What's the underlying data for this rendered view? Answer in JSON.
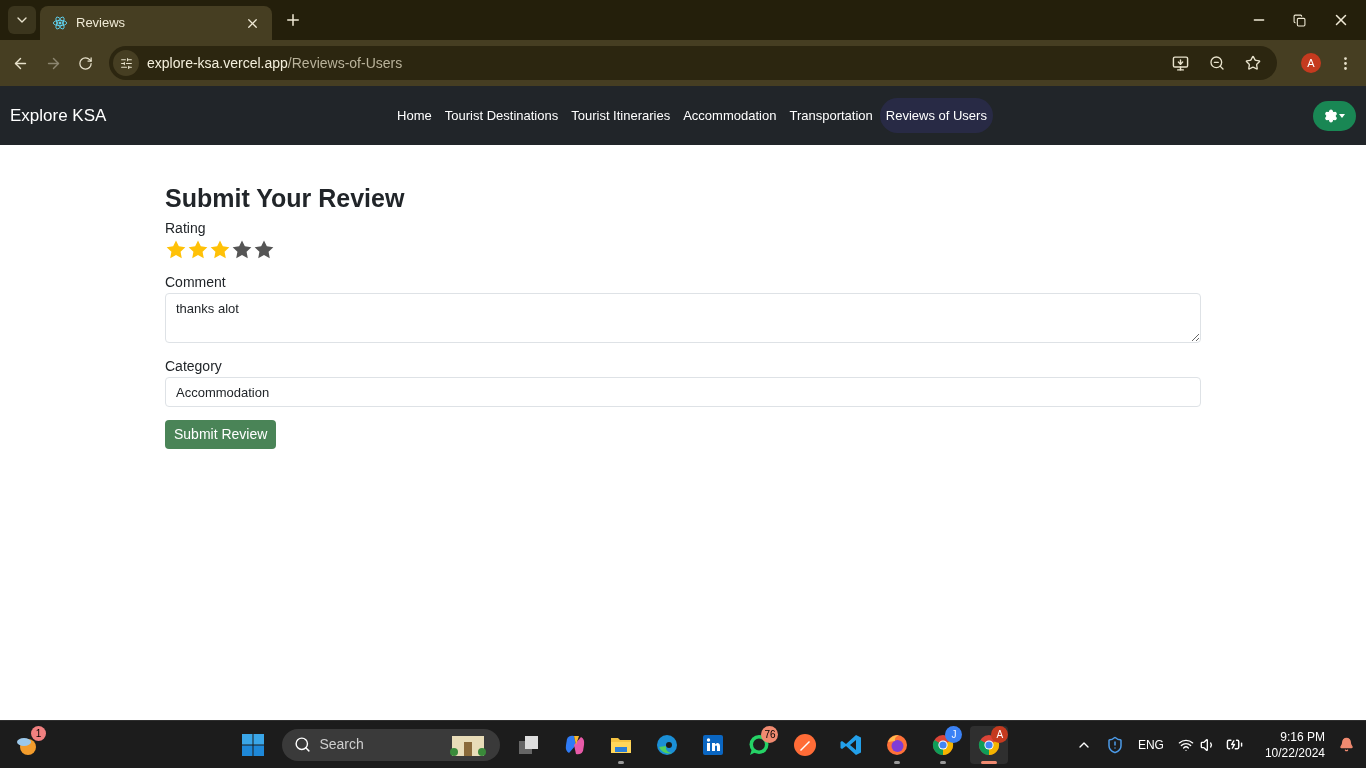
{
  "browser": {
    "tab": {
      "title": "Reviews"
    },
    "url": {
      "host": "explore-ksa.vercel.app",
      "path": "/Reviews-of-Users"
    },
    "profile": "A"
  },
  "navbar": {
    "brand": "Explore KSA",
    "links": [
      {
        "label": "Home",
        "selected": false
      },
      {
        "label": "Tourist Destinations",
        "selected": false
      },
      {
        "label": "Tourist Itineraries",
        "selected": false
      },
      {
        "label": "Accommodation",
        "selected": false
      },
      {
        "label": "Transportation",
        "selected": false
      },
      {
        "label": "Reviews of Users",
        "selected": true
      }
    ]
  },
  "form": {
    "title": "Submit Your Review",
    "rating": {
      "label": "Rating",
      "stars": 3
    },
    "comment": {
      "label": "Comment",
      "value": "thanks alot"
    },
    "category": {
      "label": "Category",
      "value": "Accommodation"
    },
    "submit": "Submit Review"
  },
  "taskbar": {
    "weather_badge": "1",
    "search": {
      "placeholder": "Search"
    },
    "apps": [
      {
        "kind": "start",
        "running": false,
        "active": false
      },
      {
        "kind": "taskview",
        "running": false,
        "active": false
      },
      {
        "kind": "copilot",
        "running": false,
        "active": false
      },
      {
        "kind": "folder",
        "running": true,
        "active": false
      },
      {
        "kind": "edge",
        "running": false,
        "active": false
      },
      {
        "kind": "linkedin",
        "running": false,
        "active": false
      },
      {
        "kind": "whatsapp",
        "running": false,
        "active": false,
        "badge": "76"
      },
      {
        "kind": "postman",
        "running": false,
        "active": false
      },
      {
        "kind": "vscode",
        "running": false,
        "active": false
      },
      {
        "kind": "firefox",
        "running": true,
        "active": false
      },
      {
        "kind": "chrome",
        "running": true,
        "active": false,
        "badge": "J"
      },
      {
        "kind": "chrome",
        "running": true,
        "active": true,
        "badge": "A"
      }
    ],
    "language": "ENG",
    "time": "9:16 PM",
    "date": "10/22/2024"
  }
}
